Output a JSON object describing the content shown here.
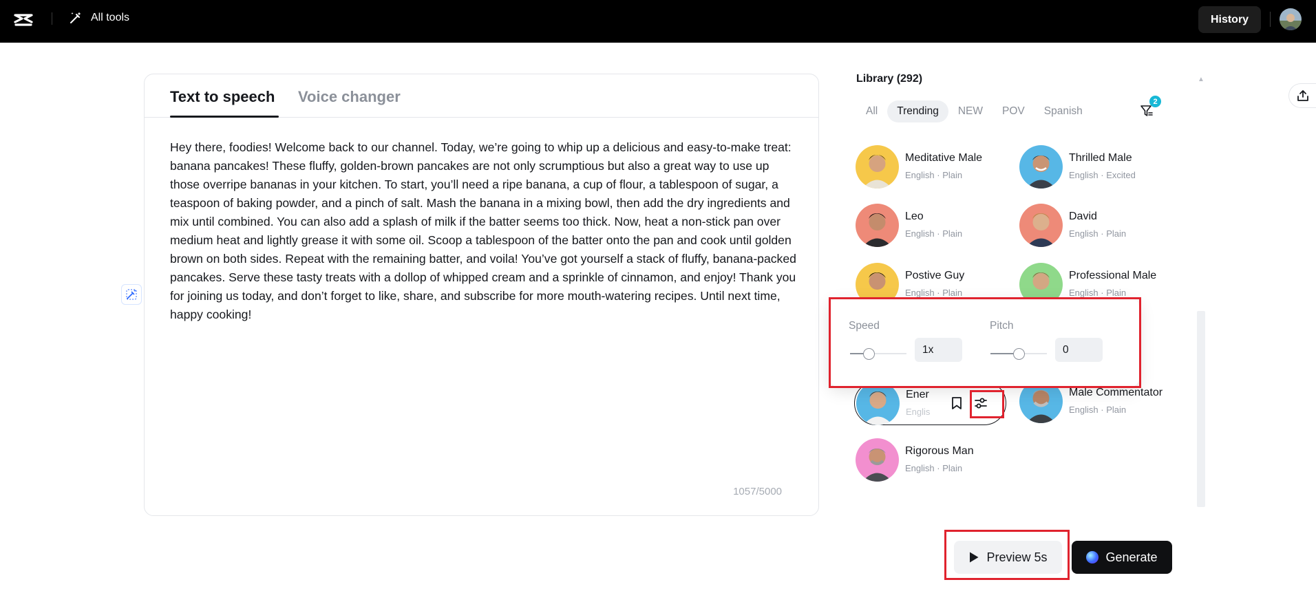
{
  "topbar": {
    "all_tools_label": "All tools",
    "history_label": "History"
  },
  "editor": {
    "tabs": [
      {
        "label": "Text to speech",
        "active": true
      },
      {
        "label": "Voice changer",
        "active": false
      }
    ],
    "script_text": "Hey there, foodies! Welcome back to our channel. Today, we’re going to whip up a delicious and easy-to-make treat: banana pancakes! These fluffy, golden-brown pancakes are not only scrumptious but also a great way to use up those overripe bananas in your kitchen. To start, you’ll need a ripe banana, a cup of flour, a tablespoon of sugar, a teaspoon of baking powder, and a pinch of salt. Mash the banana in a mixing bowl, then add the dry ingredients and mix until combined. You can also add a splash of milk if the batter seems too thick. Now, heat a non-stick pan over medium heat and lightly grease it with some oil. Scoop a tablespoon of the batter onto the pan and cook until golden brown on both sides. Repeat with the remaining batter, and voila! You’ve got yourself a stack of fluffy, banana-packed pancakes. Serve these tasty treats with a dollop of whipped cream and a sprinkle of cinnamon, and enjoy! Thank you for joining us today, and don’t forget to like, share, and subscribe for more mouth-watering recipes. Until next time, happy cooking!",
    "char_count": "1057/5000"
  },
  "library": {
    "title": "Library (292)",
    "filter_badge": "2",
    "filters": [
      "All",
      "Trending",
      "NEW",
      "POV",
      "Spanish"
    ],
    "active_filter": "Trending",
    "voices": [
      {
        "name": "Meditative Male",
        "meta": "English · Plain",
        "bg": "#f6c84a"
      },
      {
        "name": "Thrilled Male",
        "meta": "English · Excited",
        "bg": "#57b7e6"
      },
      {
        "name": "Leo",
        "meta": "English · Plain",
        "bg": "#ee8a78"
      },
      {
        "name": "David",
        "meta": "English · Plain",
        "bg": "#ee8a78"
      },
      {
        "name": "Postive Guy",
        "meta": "English · Plain",
        "bg": "#f6c84a"
      },
      {
        "name": "Professional Male",
        "meta": "English · Plain",
        "bg": "#8fd98a"
      },
      {
        "name": "Ener",
        "meta": "Englis",
        "bg": "#57b7e6"
      },
      {
        "name": "Male Commentator",
        "meta": "English · Plain",
        "bg": "#57b7e6"
      },
      {
        "name": "Rigorous Man",
        "meta": "English · Plain",
        "bg": "#f28fcf"
      }
    ]
  },
  "popover": {
    "speed_label": "Speed",
    "speed_value": "1x",
    "speed_fraction": 0.33,
    "pitch_label": "Pitch",
    "pitch_value": "0",
    "pitch_fraction": 0.5
  },
  "actions": {
    "preview_label": "Preview 5s",
    "generate_label": "Generate"
  },
  "colors": {
    "highlight": "#e0232e",
    "badge": "#17b8d6"
  }
}
